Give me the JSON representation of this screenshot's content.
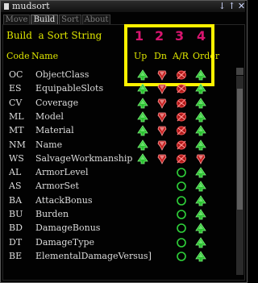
{
  "window": {
    "title": "mudsort",
    "controls": [
      "↓",
      "↑",
      "✕"
    ]
  },
  "tabs": [
    {
      "label": "Move",
      "active": false
    },
    {
      "label": "Build",
      "active": true
    },
    {
      "label": "Sort",
      "active": false
    },
    {
      "label": "About",
      "active": false
    }
  ],
  "heading": "Build  a Sort String",
  "annotations": [
    "1",
    "2",
    "3",
    "4"
  ],
  "columns": {
    "code": "Code",
    "name": "Name",
    "up": "Up",
    "dn": "Dn",
    "ar": "A/R",
    "order": "Order"
  },
  "colors": {
    "accent_yellow": "#dfe600",
    "annotation_pink": "#d8156f",
    "highlight_yellow": "#fff200"
  },
  "rows": [
    {
      "code": "OC",
      "name": "ObjectClass",
      "up": "green-up",
      "dn": "red-down",
      "ar": "red-remove",
      "order": "green-up"
    },
    {
      "code": "ES",
      "name": "EquipableSlots",
      "up": "green-up",
      "dn": "red-down",
      "ar": "red-remove",
      "order": "green-up"
    },
    {
      "code": "CV",
      "name": "Coverage",
      "up": "green-up",
      "dn": "red-down",
      "ar": "red-remove",
      "order": "green-up"
    },
    {
      "code": "ML",
      "name": "Model",
      "up": "green-up",
      "dn": "red-down",
      "ar": "red-remove",
      "order": "green-up"
    },
    {
      "code": "MT",
      "name": "Material",
      "up": "green-up",
      "dn": "red-down",
      "ar": "red-remove",
      "order": "green-up"
    },
    {
      "code": "NM",
      "name": "Name",
      "up": "green-up",
      "dn": "red-down",
      "ar": "red-remove",
      "order": "green-up"
    },
    {
      "code": "WS",
      "name": "SalvageWorkmanship",
      "up": "green-up",
      "dn": "red-down",
      "ar": "red-remove",
      "order": "red-down"
    },
    {
      "code": "AL",
      "name": "ArmorLevel",
      "up": "",
      "dn": "",
      "ar": "green-add",
      "order": "green-up"
    },
    {
      "code": "AS",
      "name": "ArmorSet",
      "up": "",
      "dn": "",
      "ar": "green-add",
      "order": "green-up"
    },
    {
      "code": "BA",
      "name": "AttackBonus",
      "up": "",
      "dn": "",
      "ar": "green-add",
      "order": "green-up"
    },
    {
      "code": "BU",
      "name": "Burden",
      "up": "",
      "dn": "",
      "ar": "green-add",
      "order": "green-up"
    },
    {
      "code": "BD",
      "name": "DamageBonus",
      "up": "",
      "dn": "",
      "ar": "green-add",
      "order": "green-up"
    },
    {
      "code": "DT",
      "name": "DamageType",
      "up": "",
      "dn": "",
      "ar": "green-add",
      "order": "green-up"
    },
    {
      "code": "BE",
      "name": "ElementalDamageVersus]",
      "up": "",
      "dn": "",
      "ar": "green-add",
      "order": "green-up"
    }
  ]
}
